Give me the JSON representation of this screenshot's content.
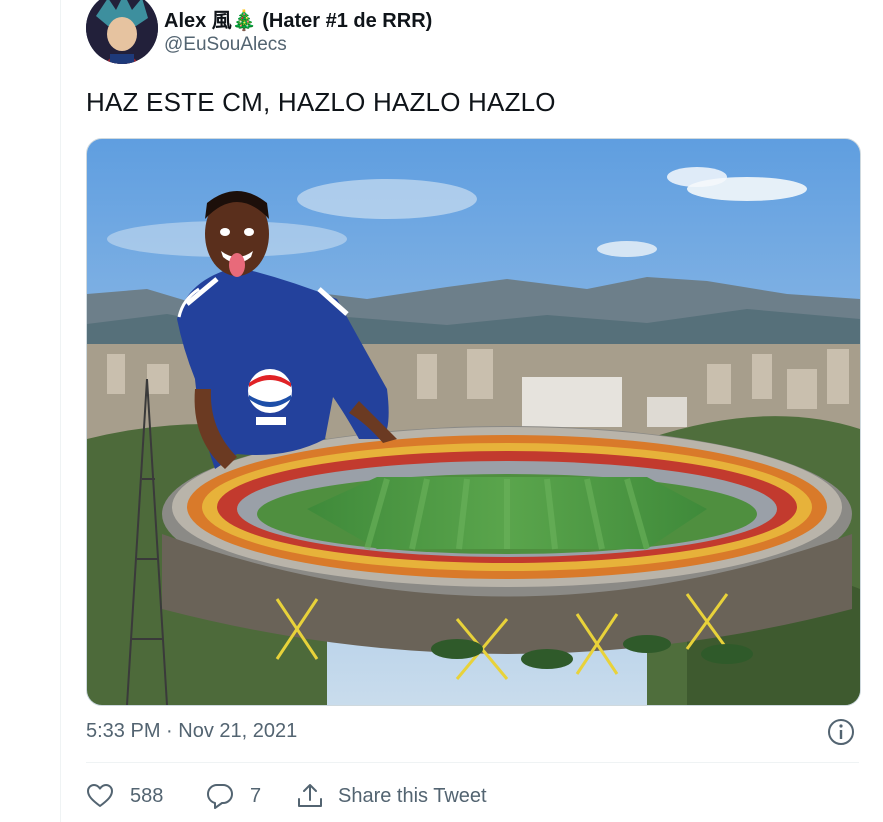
{
  "author": {
    "display_name": "Alex 風🎄 (Hater #1 de RRR)",
    "handle": "@EuSouAlecs"
  },
  "tweet": {
    "text": "HAZ ESTE CM, HAZLO HAZLO HAZLO",
    "timestamp": "5:33 PM · Nov 21, 2021"
  },
  "media": {
    "description_icon": "photo-image",
    "player_jersey_sponsor_text": "Pepsi"
  },
  "actions": {
    "likes": "588",
    "replies": "7",
    "share_label": "Share this Tweet"
  },
  "icons": {
    "like": "heart-icon",
    "reply": "speech-bubble-icon",
    "share": "share-upload-icon",
    "info": "info-circle-icon"
  },
  "colors": {
    "text_primary": "#0f1419",
    "text_secondary": "#536471",
    "border": "#cfd9de"
  }
}
